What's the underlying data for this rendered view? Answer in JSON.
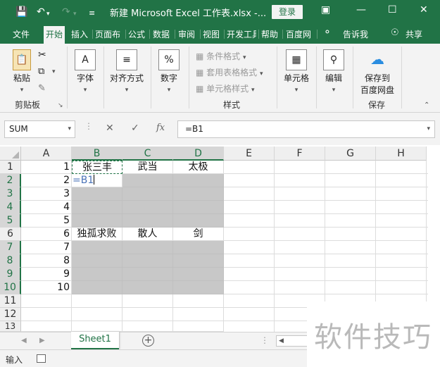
{
  "titlebar": {
    "title": "新建 Microsoft Excel 工作表.xlsx  -...",
    "login": "登录",
    "save_icon": "save-icon",
    "undo_icon": "undo-icon",
    "redo_icon": "redo-icon",
    "customize_icon": "chevron-down-icon"
  },
  "tabs": [
    "文件",
    "开始",
    "插入",
    "页面布",
    "公式",
    "数据",
    "审阅",
    "视图",
    "开发工具",
    "帮助",
    "百度网",
    "告诉我",
    "共享"
  ],
  "active_tab": "开始",
  "ribbon": {
    "clipboard": {
      "paste": "粘贴",
      "label": "剪贴板"
    },
    "font": "字体",
    "alignment": "对齐方式",
    "number": "数字",
    "styles": {
      "conditional": "条件格式",
      "table": "套用表格格式",
      "cell": "单元格样式",
      "label": "样式"
    },
    "cells": "单元格",
    "editing": "编辑",
    "save": {
      "line1": "保存到",
      "line2": "百度网盘",
      "label": "保存"
    }
  },
  "formula_bar": {
    "name_box": "SUM",
    "formula": "=B1"
  },
  "grid": {
    "columns": [
      "A",
      "B",
      "C",
      "D",
      "E",
      "F",
      "G",
      "H"
    ],
    "rows": [
      "1",
      "2",
      "3",
      "4",
      "5",
      "6",
      "7",
      "8",
      "9",
      "10",
      "11",
      "12",
      "13"
    ],
    "col_a_values": [
      "1",
      "2",
      "3",
      "4",
      "5",
      "6",
      "7",
      "8",
      "9",
      "10"
    ],
    "row1": [
      "张三丰",
      "武当",
      "太极"
    ],
    "row6": [
      "独孤求败",
      "散人",
      "剑"
    ],
    "edit_cell": "=B1"
  },
  "sheet_tab": "Sheet1",
  "status": "输入",
  "watermark": "软件技巧",
  "colors": {
    "brand": "#217346",
    "selection_gray": "#c8c8c8"
  }
}
